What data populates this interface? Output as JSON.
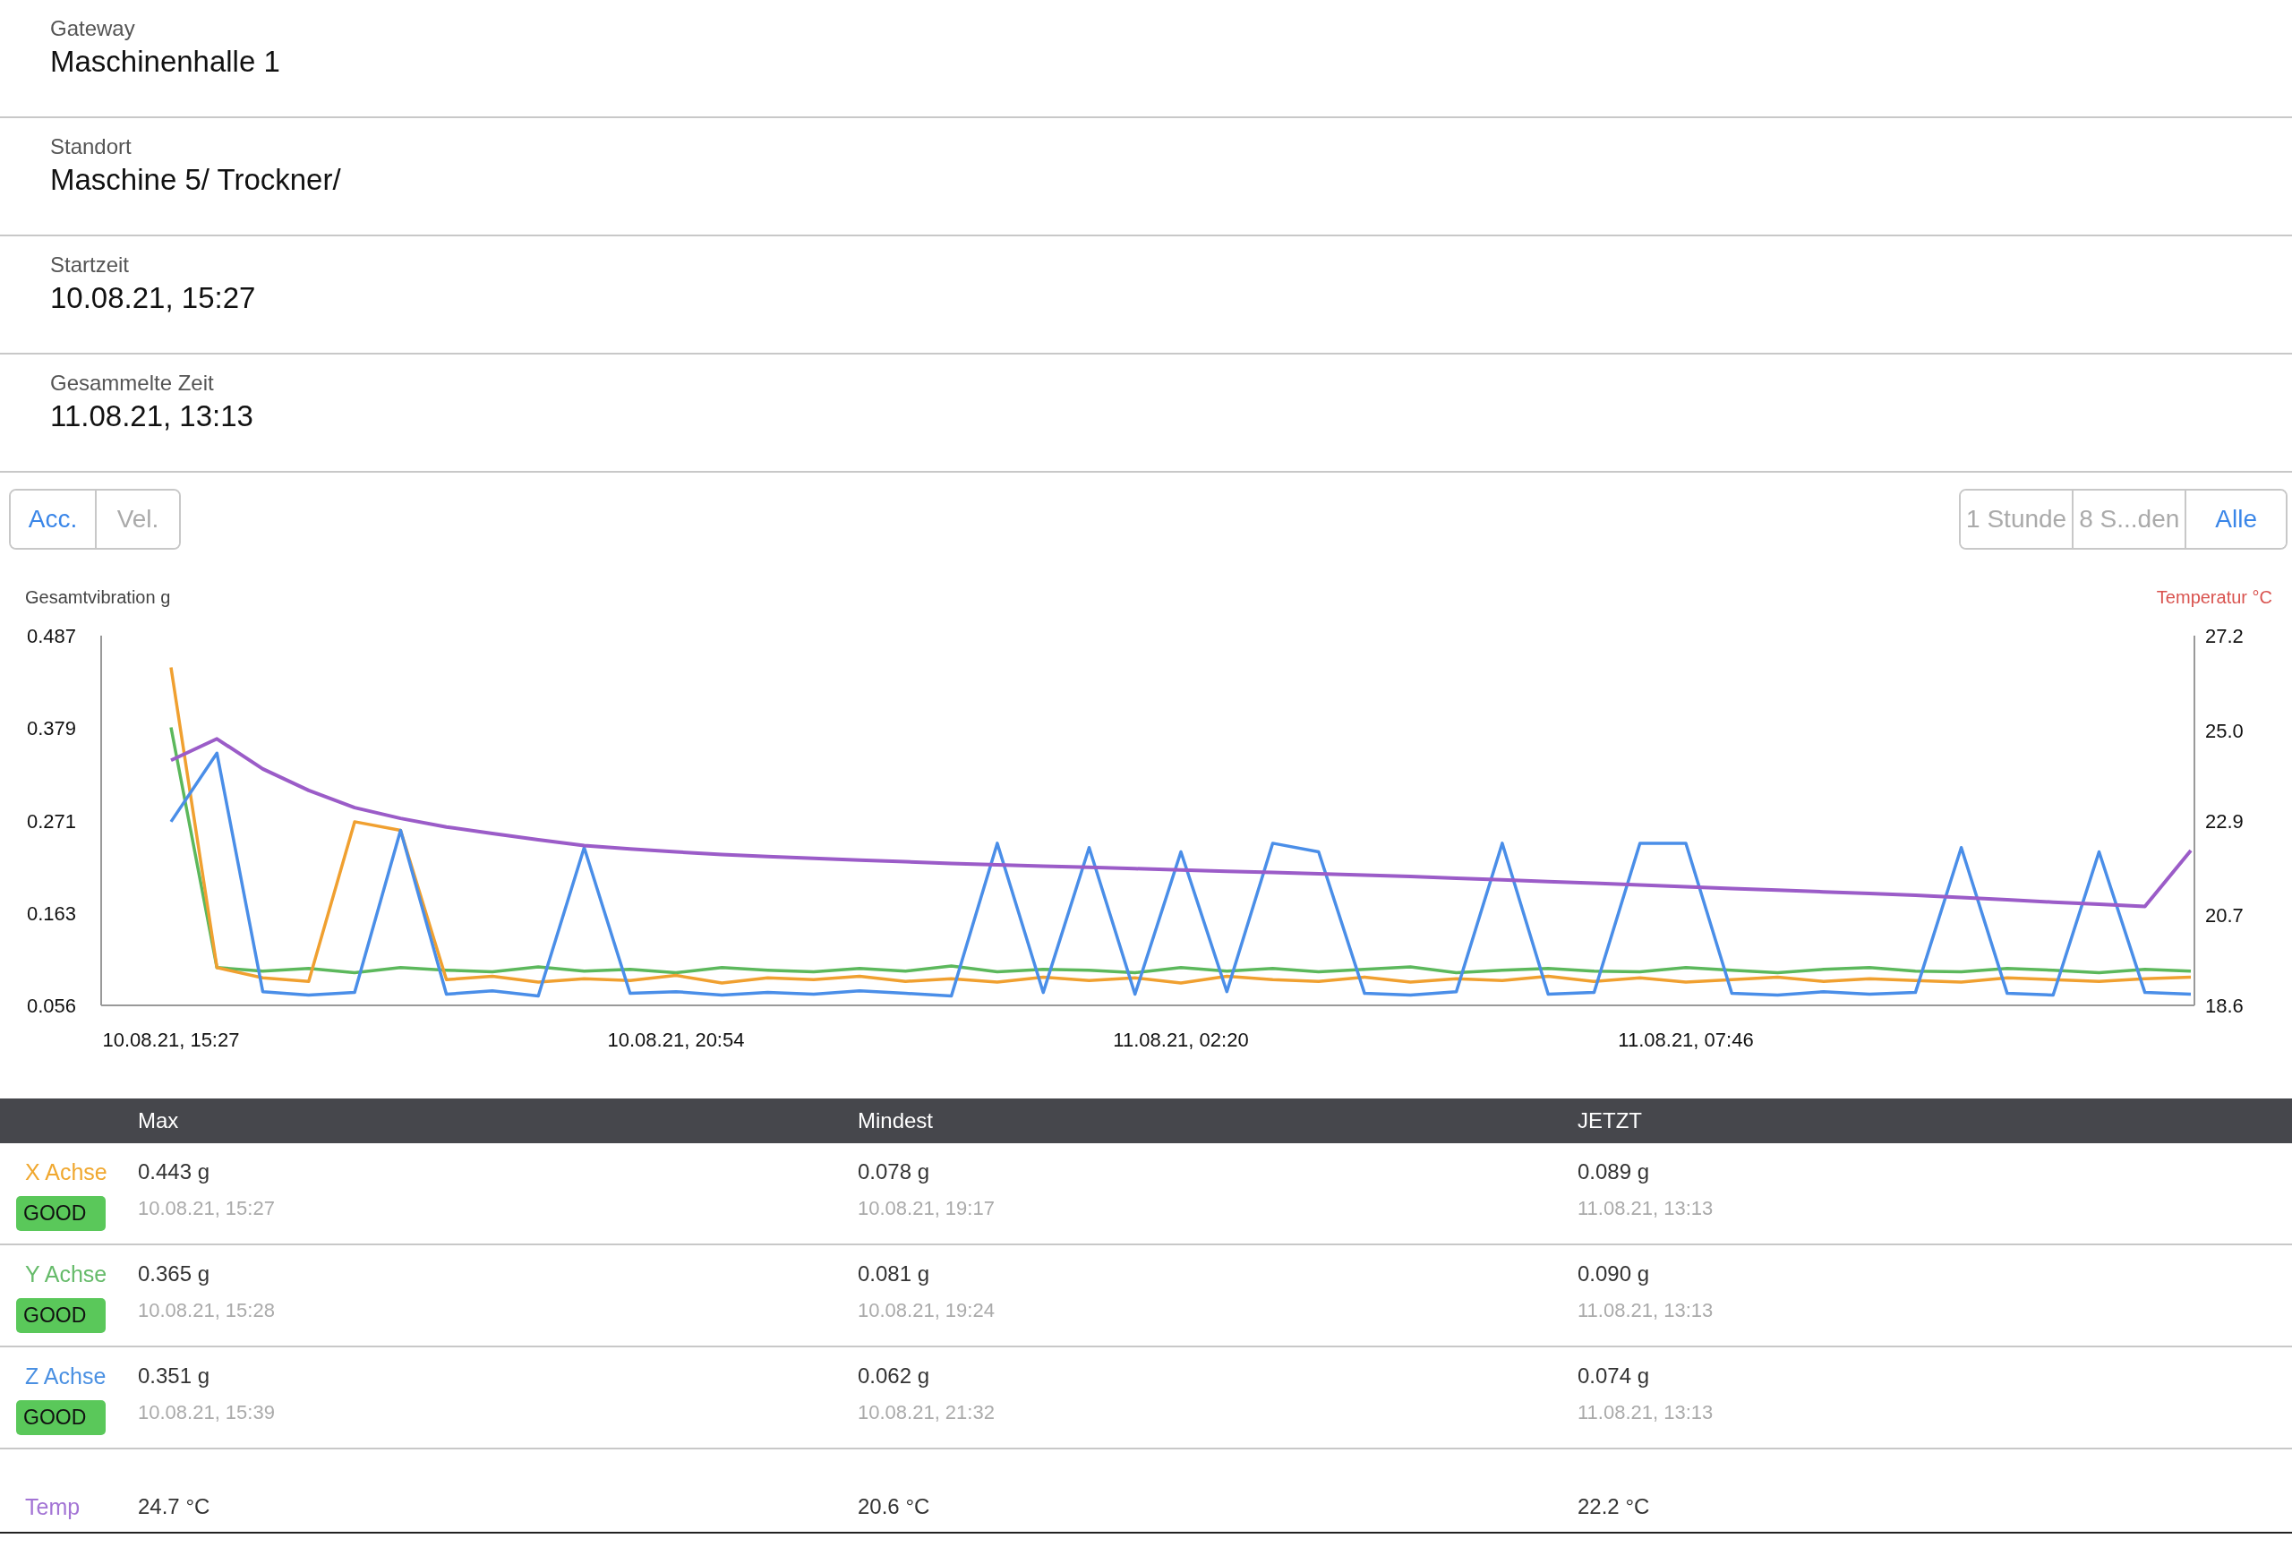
{
  "info": [
    {
      "label": "Gateway",
      "value": "Maschinenhalle 1"
    },
    {
      "label": "Standort",
      "value": "Maschine 5/ Trockner/"
    },
    {
      "label": "Startzeit",
      "value": "10.08.21, 15:27"
    },
    {
      "label": "Gesammelte Zeit",
      "value": "11.08.21, 13:13"
    }
  ],
  "measure_tabs": [
    {
      "label": "Acc.",
      "selected": true
    },
    {
      "label": "Vel.",
      "selected": false
    }
  ],
  "range_tabs": [
    {
      "label": "1 Stunde",
      "selected": false
    },
    {
      "label": "8 S...den",
      "selected": false
    },
    {
      "label": "Alle",
      "selected": true
    }
  ],
  "chart": {
    "left_title": "Gesamtvibration g",
    "right_title": "Temperatur °C",
    "chart_data": {
      "type": "line",
      "categories": [
        "10.08.21, 15:27",
        null,
        null,
        null,
        null,
        null,
        null,
        null,
        null,
        null,
        null,
        "10.08.21, 20:54",
        null,
        null,
        null,
        null,
        null,
        null,
        null,
        null,
        null,
        null,
        "11.08.21, 02:20",
        null,
        null,
        null,
        null,
        null,
        null,
        null,
        null,
        null,
        null,
        "11.08.21, 07:46",
        null,
        null,
        null,
        null,
        null,
        null,
        null,
        null,
        null,
        null,
        null
      ],
      "ylim": [
        0.056,
        0.487
      ],
      "yticks": [
        0.056,
        0.163,
        0.271,
        0.379,
        0.487
      ],
      "y2lim": [
        18.6,
        27.2
      ],
      "y2ticks": [
        {
          "value": 18.6,
          "label": "18.6"
        },
        {
          "value": 20.7,
          "label": "20.7"
        },
        {
          "value": 22.9,
          "label": "22.9"
        },
        {
          "value": 25.0,
          "label": "25.0"
        },
        {
          "value": 27.2,
          "label": "27.2"
        }
      ],
      "series": [
        {
          "color": "#5cb85c",
          "values": [
            0.38,
            0.1,
            0.096,
            0.099,
            0.094,
            0.1,
            0.097,
            0.095,
            0.101,
            0.096,
            0.098,
            0.094,
            0.1,
            0.097,
            0.095,
            0.099,
            0.096,
            0.102,
            0.095,
            0.098,
            0.097,
            0.094,
            0.1,
            0.096,
            0.099,
            0.095,
            0.098,
            0.101,
            0.094,
            0.097,
            0.099,
            0.096,
            0.095,
            0.1,
            0.097,
            0.094,
            0.098,
            0.1,
            0.096,
            0.095,
            0.099,
            0.097,
            0.094,
            0.098,
            0.096
          ]
        },
        {
          "color": "#f0a030",
          "values": [
            0.45,
            0.1,
            0.088,
            0.084,
            0.27,
            0.26,
            0.086,
            0.09,
            0.083,
            0.087,
            0.085,
            0.091,
            0.082,
            0.088,
            0.086,
            0.09,
            0.084,
            0.087,
            0.083,
            0.089,
            0.085,
            0.088,
            0.082,
            0.09,
            0.086,
            0.084,
            0.089,
            0.083,
            0.087,
            0.085,
            0.09,
            0.084,
            0.088,
            0.083,
            0.086,
            0.089,
            0.084,
            0.087,
            0.085,
            0.083,
            0.088,
            0.086,
            0.084,
            0.087,
            0.089
          ]
        },
        {
          "color": "#4a8ee8",
          "values": [
            0.27,
            0.35,
            0.072,
            0.068,
            0.071,
            0.26,
            0.069,
            0.073,
            0.067,
            0.24,
            0.07,
            0.072,
            0.068,
            0.071,
            0.069,
            0.073,
            0.07,
            0.067,
            0.245,
            0.071,
            0.24,
            0.069,
            0.235,
            0.072,
            0.245,
            0.235,
            0.07,
            0.068,
            0.072,
            0.245,
            0.069,
            0.071,
            0.245,
            0.245,
            0.07,
            0.068,
            0.072,
            0.069,
            0.071,
            0.24,
            0.07,
            0.068,
            0.235,
            0.071,
            0.069
          ]
        },
        {
          "color": "#9b5cc8",
          "axis": "y2",
          "values": [
            24.3,
            24.8,
            24.1,
            23.6,
            23.2,
            22.95,
            22.75,
            22.6,
            22.45,
            22.32,
            22.24,
            22.17,
            22.11,
            22.06,
            22.02,
            21.98,
            21.94,
            21.9,
            21.87,
            21.84,
            21.81,
            21.78,
            21.75,
            21.72,
            21.69,
            21.66,
            21.63,
            21.6,
            21.56,
            21.52,
            21.48,
            21.44,
            21.4,
            21.36,
            21.32,
            21.28,
            21.24,
            21.2,
            21.16,
            21.11,
            21.06,
            21.0,
            20.95,
            20.9,
            22.2
          ]
        }
      ]
    }
  },
  "table": {
    "columns": [
      "Max",
      "Mindest",
      "JETZT"
    ],
    "rows": [
      {
        "label": "X Achse",
        "color": "#f0a830",
        "status": "GOOD",
        "cells": [
          {
            "value": "0.443 g",
            "time": "10.08.21, 15:27"
          },
          {
            "value": "0.078 g",
            "time": "10.08.21, 19:17"
          },
          {
            "value": "0.089 g",
            "time": "11.08.21, 13:13"
          }
        ]
      },
      {
        "label": "Y Achse",
        "color": "#66bb6a",
        "status": "GOOD",
        "cells": [
          {
            "value": "0.365 g",
            "time": "10.08.21, 15:28"
          },
          {
            "value": "0.081 g",
            "time": "10.08.21, 19:24"
          },
          {
            "value": "0.090 g",
            "time": "11.08.21, 13:13"
          }
        ]
      },
      {
        "label": "Z Achse",
        "color": "#4a90e2",
        "status": "GOOD",
        "cells": [
          {
            "value": "0.351 g",
            "time": "10.08.21, 15:39"
          },
          {
            "value": "0.062 g",
            "time": "10.08.21, 21:32"
          },
          {
            "value": "0.074 g",
            "time": "11.08.21, 13:13"
          }
        ]
      },
      {
        "label": "Temp",
        "color": "#a374d5",
        "cells": [
          {
            "value": "24.7 °C"
          },
          {
            "value": "20.6 °C"
          },
          {
            "value": "22.2 °C"
          }
        ]
      }
    ]
  }
}
